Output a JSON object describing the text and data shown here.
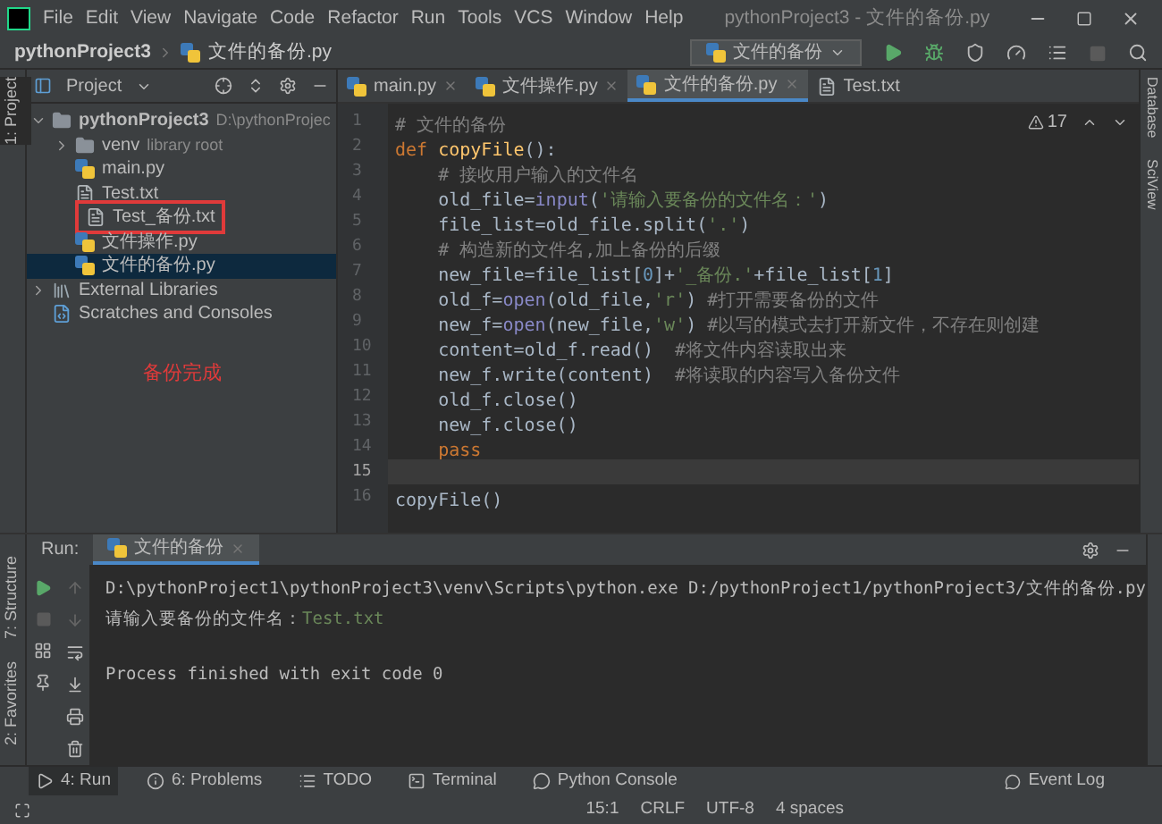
{
  "window": {
    "title": "pythonProject3 - 文件的备份.py"
  },
  "menu": [
    "File",
    "Edit",
    "View",
    "Navigate",
    "Code",
    "Refactor",
    "Run",
    "Tools",
    "VCS",
    "Window",
    "Help"
  ],
  "breadcrumb": [
    "pythonProject3",
    "文件的备份.py"
  ],
  "run_config": "文件的备份",
  "left_stripe": [
    {
      "label": "1: Project",
      "selected": true
    }
  ],
  "project_panel": {
    "title": "Project",
    "tree": [
      {
        "name": "pythonProject3",
        "kind": "folder",
        "note": "D:\\pythonProjec",
        "bold": true,
        "expanded": true,
        "selected": false,
        "children": [
          {
            "name": "venv",
            "kind": "folder",
            "note": "library root",
            "expanded": false,
            "selected": false
          },
          {
            "name": "main.py",
            "kind": "python",
            "selected": false
          },
          {
            "name": "Test.txt",
            "kind": "text",
            "selected": false
          },
          {
            "name": "Test_备份.txt",
            "kind": "text",
            "selected": false,
            "annotated": true
          },
          {
            "name": "文件操作.py",
            "kind": "python",
            "selected": false
          },
          {
            "name": "文件的备份.py",
            "kind": "python",
            "selected": true
          }
        ]
      },
      {
        "name": "External Libraries",
        "kind": "library",
        "expanded": false,
        "selected": false
      },
      {
        "name": "Scratches and Consoles",
        "kind": "scratch",
        "selected": false
      }
    ],
    "annotation": "备份完成"
  },
  "editor_tabs": [
    {
      "label": "main.py",
      "kind": "python",
      "selected": false
    },
    {
      "label": "文件操作.py",
      "kind": "python",
      "selected": false
    },
    {
      "label": "文件的备份.py",
      "kind": "python",
      "selected": true
    },
    {
      "label": "Test.txt",
      "kind": "text",
      "selected": false
    }
  ],
  "inspections": "17",
  "code": [
    {
      "number": "1",
      "segments": [
        {
          "kind": "comment",
          "text": "# 文件的备份"
        }
      ]
    },
    {
      "number": "2",
      "segments": [
        {
          "kind": "keyword",
          "text": "def "
        },
        {
          "kind": "function",
          "text": "copyFile"
        },
        {
          "kind": "text",
          "text": "():"
        }
      ]
    },
    {
      "number": "3",
      "segments": [
        {
          "kind": "comment",
          "text": "    # 接收用户输入的文件名"
        }
      ]
    },
    {
      "number": "4",
      "segments": [
        {
          "kind": "text",
          "text": "    old_file="
        },
        {
          "kind": "builtin",
          "text": "input"
        },
        {
          "kind": "text",
          "text": "("
        },
        {
          "kind": "string",
          "text": "'请输入要备份的文件名：'"
        },
        {
          "kind": "text",
          "text": ")"
        }
      ]
    },
    {
      "number": "5",
      "segments": [
        {
          "kind": "text",
          "text": "    file_list=old_file.split("
        },
        {
          "kind": "string",
          "text": "'.'"
        },
        {
          "kind": "text",
          "text": ")"
        }
      ]
    },
    {
      "number": "6",
      "segments": [
        {
          "kind": "comment",
          "text": "    # 构造新的文件名,加上备份的后缀"
        }
      ]
    },
    {
      "number": "7",
      "segments": [
        {
          "kind": "text",
          "text": "    new_file=file_list["
        },
        {
          "kind": "number",
          "text": "0"
        },
        {
          "kind": "text",
          "text": "]+"
        },
        {
          "kind": "string",
          "text": "'_备份.'"
        },
        {
          "kind": "text",
          "text": "+file_list["
        },
        {
          "kind": "number",
          "text": "1"
        },
        {
          "kind": "text",
          "text": "]"
        }
      ]
    },
    {
      "number": "8",
      "segments": [
        {
          "kind": "text",
          "text": "    old_f="
        },
        {
          "kind": "builtin",
          "text": "open"
        },
        {
          "kind": "text",
          "text": "(old_file,"
        },
        {
          "kind": "string",
          "text": "'r'"
        },
        {
          "kind": "text",
          "text": ") "
        },
        {
          "kind": "comment",
          "text": "#打开需要备份的文件"
        }
      ]
    },
    {
      "number": "9",
      "segments": [
        {
          "kind": "text",
          "text": "    new_f="
        },
        {
          "kind": "builtin",
          "text": "open"
        },
        {
          "kind": "text",
          "text": "(new_file,"
        },
        {
          "kind": "string",
          "text": "'w'"
        },
        {
          "kind": "text",
          "text": ") "
        },
        {
          "kind": "comment",
          "text": "#以写的模式去打开新文件，不存在则创建"
        }
      ]
    },
    {
      "number": "10",
      "segments": [
        {
          "kind": "text",
          "text": "    content=old_f.read()  "
        },
        {
          "kind": "comment",
          "text": "#将文件内容读取出来"
        }
      ]
    },
    {
      "number": "11",
      "segments": [
        {
          "kind": "text",
          "text": "    new_f.write(content)  "
        },
        {
          "kind": "comment",
          "text": "#将读取的内容写入备份文件"
        }
      ]
    },
    {
      "number": "12",
      "segments": [
        {
          "kind": "text",
          "text": "    old_f.close()"
        }
      ]
    },
    {
      "number": "13",
      "segments": [
        {
          "kind": "text",
          "text": "    new_f.close()"
        }
      ]
    },
    {
      "number": "14",
      "segments": [
        {
          "kind": "keyword",
          "text": "    pass"
        }
      ]
    },
    {
      "number": "15",
      "current": true
    },
    {
      "number": "16",
      "segments": [
        {
          "kind": "text",
          "text": "copyFile()"
        }
      ]
    }
  ],
  "right_stripe": [
    "Database",
    "SciView"
  ],
  "run_panel": {
    "label": "Run:",
    "tab": "文件的备份",
    "output": [
      {
        "text": "D:\\pythonProject1\\pythonProject3\\venv\\Scripts\\python.exe D:/pythonProject1/pythonProject3/文件的备份.py"
      },
      {
        "text": "请输入要备份的文件名：",
        "input": "Test.txt"
      },
      {
        "text": "Process finished with exit code 0"
      }
    ]
  },
  "side_tools": [
    {
      "label": "7: Structure"
    },
    {
      "label": "2: Favorites"
    }
  ],
  "tool_tabs": [
    {
      "label": "4: Run",
      "kind": "run",
      "selected": true
    },
    {
      "label": "6: Problems",
      "kind": "problems",
      "selected": false
    },
    {
      "label": "TODO",
      "kind": "todo",
      "selected": false
    },
    {
      "label": "Terminal",
      "kind": "terminal",
      "selected": false
    },
    {
      "label": "Python Console",
      "kind": "console",
      "selected": false
    }
  ],
  "event_log": "Event Log",
  "status_bar": [
    "15:1",
    "CRLF",
    "UTF-8",
    "4 spaces"
  ]
}
